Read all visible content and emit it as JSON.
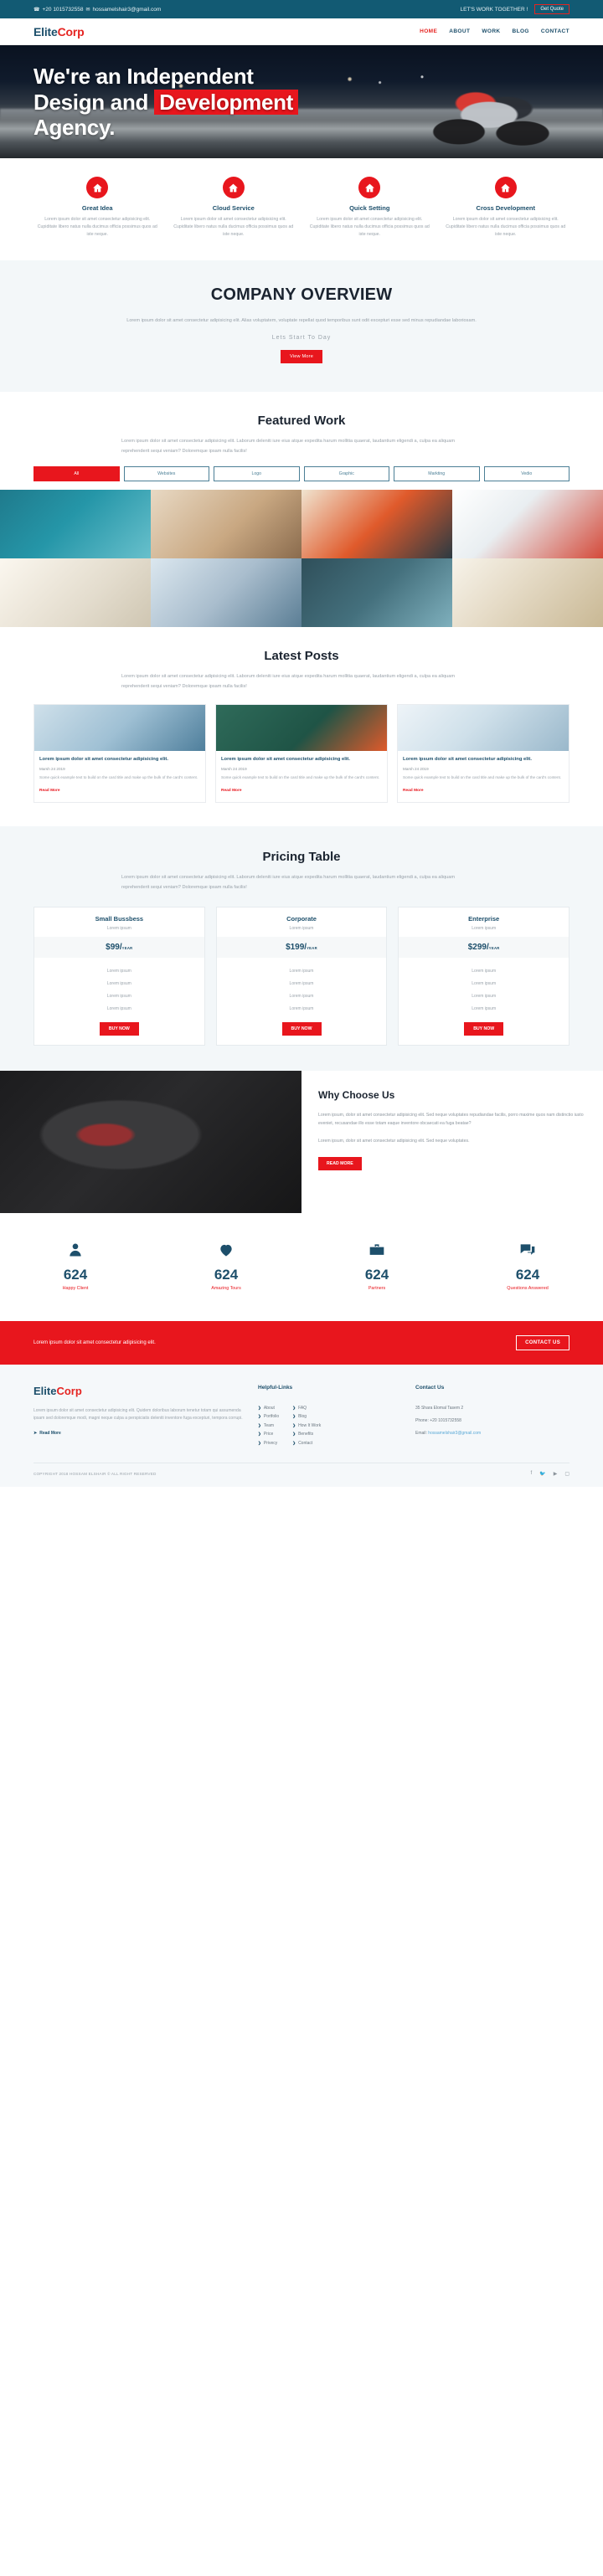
{
  "topbar": {
    "phone": "+20 1015732558",
    "email": "hossamelshair3@gmail.com",
    "tagline": "LET'S WORK TOGETHER !",
    "quote_button": "Get Quote",
    "bg_color": "#125a73"
  },
  "nav": {
    "logo_first": "Elite",
    "logo_second": "Corp",
    "items": [
      {
        "label": "HOME",
        "active": true
      },
      {
        "label": "ABOUT",
        "active": false
      },
      {
        "label": "WORK",
        "active": false
      },
      {
        "label": "BLOG",
        "active": false
      },
      {
        "label": "CONTACT",
        "active": false
      }
    ]
  },
  "hero": {
    "line1": "We're an Independent",
    "line2_a": "Design and",
    "line2_b": "Development",
    "line3": "Agency.",
    "highlight_color": "#e8161d"
  },
  "services": [
    {
      "icon": "home-icon",
      "title": "Great Idea",
      "text": "Lorem ipsum dolor sit amet consectetur adipisicing elit. Cupiditate libero natus nulla ducimus officia possimus quos ad iste neque."
    },
    {
      "icon": "home-icon",
      "title": "Cloud Service",
      "text": "Lorem ipsum dolor sit amet consectetur adipisicing elit. Cupiditate libero natus nulla ducimus officia possimus quos ad iste neque."
    },
    {
      "icon": "home-icon",
      "title": "Quick Setting",
      "text": "Lorem ipsum dolor sit amet consectetur adipisicing elit. Cupiditate libero natus nulla ducimus officia possimus quos ad iste neque."
    },
    {
      "icon": "home-icon",
      "title": "Cross Development",
      "text": "Lorem ipsum dolor sit amet consectetur adipisicing elit. Cupiditate libero natus nulla ducimus officia possimus quos ad iste neque."
    }
  ],
  "overview": {
    "title": "COMPANY OVERVIEW",
    "text": "Lorem ipsum dolor sit amet consectetur adipisicing elit. Alias voluptatem, voluptate repellat quod temporibus sunt odit excepturi esse sed minus repudiandae laboriosam.",
    "subtitle": "Lets Start To Day",
    "button": "View More"
  },
  "featured": {
    "title": "Featured Work",
    "text": "Lorem ipsum dolor sit amet consectetur adipisicing elit. Laborum deleniti iure eius atque expedita harum mollitia quaerat, laudantium eligendi a, culpa ea aliquam reprehenderit sequi veniam? Doloremque ipsam nulla facilis!",
    "filters": [
      {
        "label": "All",
        "active": true
      },
      {
        "label": "Websites",
        "active": false
      },
      {
        "label": "Logo",
        "active": false
      },
      {
        "label": "Graphic",
        "active": false
      },
      {
        "label": "Markting",
        "active": false
      },
      {
        "label": "Vedio",
        "active": false
      }
    ]
  },
  "posts_section": {
    "title": "Latest Posts",
    "text": "Lorem ipsum dolor sit amet consectetur adipisicing elit. Laborum deleniti iure eius atque expedita harum mollitia quaerat, laudantium eligendi a, culpa ea aliquam reprehenderit sequi veniam? Doloremque ipsam nulla facilis!"
  },
  "posts": [
    {
      "title": "Lorem ipsum dolor sit amet consectetur adipisicing elit.",
      "date": "Marsh 24 2019",
      "excerpt": "Some quick example text to build on the card title and make up the bulk of the card's content.",
      "link": "Read More"
    },
    {
      "title": "Lorem ipsum dolor sit amet consectetur adipisicing elit.",
      "date": "Marsh 24 2019",
      "excerpt": "Some quick example text to build on the card title and make up the bulk of the card's content.",
      "link": "Read More"
    },
    {
      "title": "Lorem ipsum dolor sit amet consectetur adipisicing elit.",
      "date": "Marsh 24 2019",
      "excerpt": "Some quick example text to build on the card title and make up the bulk of the card's content.",
      "link": "Read More"
    }
  ],
  "pricing": {
    "title": "Pricing Table",
    "text": "Lorem ipsum dolor sit amet consectetur adipisicing elit. Laborum deleniti iure eius atque expedita harum mollitia quaerat, laudantium eligendi a, culpa ea aliquam reprehenderit sequi veniam? Doloremque ipsam nulla facilis!",
    "plans": [
      {
        "name": "Small Bussbess",
        "sub": "Lorem ipsum",
        "price": "$99/",
        "period": "YEAR",
        "features": [
          "Lorem ipsum",
          "Lorem ipsum",
          "Lorem ipsum",
          "Lorem ipsum"
        ],
        "button": "BUY NOW"
      },
      {
        "name": "Corporate",
        "sub": "Lorem ipsum",
        "price": "$199/",
        "period": "YEAR",
        "features": [
          "Lorem ipsum",
          "Lorem ipsum",
          "Lorem ipsum",
          "Lorem ipsum"
        ],
        "button": "BUY NOW"
      },
      {
        "name": "Enterprise",
        "sub": "Lorem ipsum",
        "price": "$299/",
        "period": "YEAR",
        "features": [
          "Lorem ipsum",
          "Lorem ipsum",
          "Lorem ipsum",
          "Lorem ipsum"
        ],
        "button": "BUY NOW"
      }
    ]
  },
  "why": {
    "title": "Why Choose Us",
    "p1": "Lorem ipsum, dolor sit amet consectetur adipisicing elit. Sed neque voluptates repudiandae facilis, porro maxime quos nam distinctio iusto eveniet, recusandae illo esse totam eaque inventore obcaecati ea fuga beatae?",
    "p2": "Lorem ipsum, dolor sit amet consectetur adipisicing elit. Sed neque voluptates.",
    "button": "READ MORE"
  },
  "counters": [
    {
      "icon": "user-icon",
      "value": "624",
      "label": "Happy Client"
    },
    {
      "icon": "heart-icon",
      "value": "624",
      "label": "Amazing Tours"
    },
    {
      "icon": "briefcase-icon",
      "value": "624",
      "label": "Partners"
    },
    {
      "icon": "comments-icon",
      "value": "624",
      "label": "Questions Answered"
    }
  ],
  "cta": {
    "text": "Lorem ipsum dolor sit amet consectetur adipisicing elit.",
    "button": "CONTACT US",
    "bg_color": "#e8161d"
  },
  "footer": {
    "logo_first": "Elite",
    "logo_second": "Corp",
    "about": "Lorem ipsum dolor sit amet consectetur adipisicing elit. Quidem doloribus laborum tenetur totam qui assumenda ipsam sed doloremque modi, magni neque culpa a perspiciatis deleniti inventore fuga excepturi, tempora corrupi.",
    "read_more": "Read More",
    "links_title": "Helpful-Links",
    "links_col1": [
      "About",
      "Portfolio",
      "Team",
      "Price",
      "Privecy"
    ],
    "links_col2": [
      "FAQ",
      "Blog",
      "How It Work",
      "Benefits",
      "Contact"
    ],
    "contact_title": "Contact Us",
    "address": "35 Shara Elomal Tasem 2",
    "phone": "Phone: +20 1015732558",
    "email_label": "Email:",
    "email": "hossamelshair3@gmail.com",
    "copyright": "COPYRIGHT 2018 HOSSAM ELSHAIR © ALL RIGHT RESERVED",
    "socials": [
      "facebook-icon",
      "twitter-icon",
      "youtube-icon",
      "instagram-icon"
    ]
  }
}
